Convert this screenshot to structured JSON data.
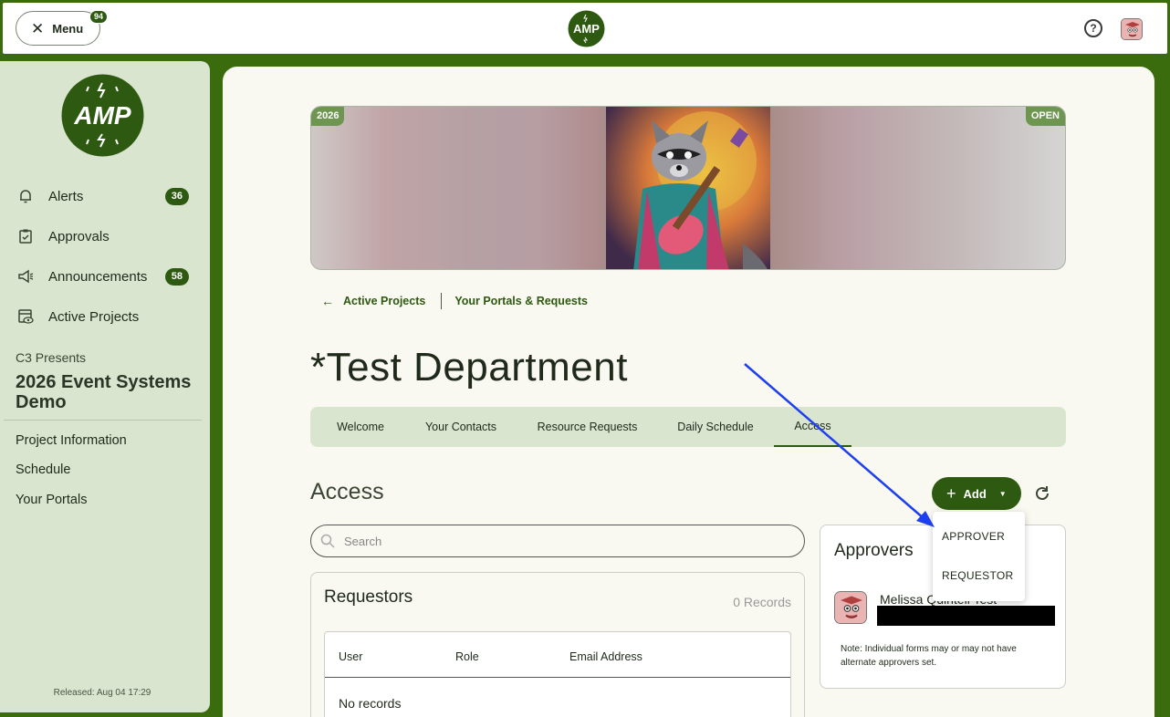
{
  "topbar": {
    "menu_label": "Menu",
    "menu_badge": "94",
    "logo_text": "AMP"
  },
  "sidebar": {
    "logo_text": "AMP",
    "nav": [
      {
        "label": "Alerts",
        "badge": "36",
        "icon": "bell-icon"
      },
      {
        "label": "Approvals",
        "badge": "",
        "icon": "clipboard-check-icon"
      },
      {
        "label": "Announcements",
        "badge": "58",
        "icon": "megaphone-icon"
      },
      {
        "label": "Active Projects",
        "badge": "",
        "icon": "calendar-eye-icon"
      }
    ],
    "org": "C3 Presents",
    "project": "2026 Event Systems Demo",
    "links": [
      "Project Information",
      "Schedule",
      "Your Portals"
    ],
    "released": "Released: Aug 04 17:29"
  },
  "banner": {
    "year_tag": "2026",
    "status_tag": "OPEN"
  },
  "breadcrumb": {
    "back": "Active Projects",
    "current": "Your Portals & Requests"
  },
  "page": {
    "title": "*Test Department"
  },
  "tabs": [
    "Welcome",
    "Your Contacts",
    "Resource Requests",
    "Daily Schedule",
    "Access"
  ],
  "access": {
    "title": "Access",
    "add_label": "Add",
    "search_placeholder": "Search",
    "dropdown": [
      "APPROVER",
      "REQUESTOR"
    ]
  },
  "requestors": {
    "title": "Requestors",
    "count": "0 Records",
    "columns": [
      "User",
      "Role",
      "Email Address"
    ],
    "empty": "No records"
  },
  "approvers": {
    "title": "Approvers",
    "name": "Melissa Quintell Test",
    "note": "Note: Individual forms may or may not have alternate approvers set."
  },
  "colors": {
    "brand_green": "#2d5a10",
    "frame_green": "#3a6b0c",
    "sidebar_bg": "#d9e5cf",
    "annotation_arrow": "#1d3ff0"
  }
}
